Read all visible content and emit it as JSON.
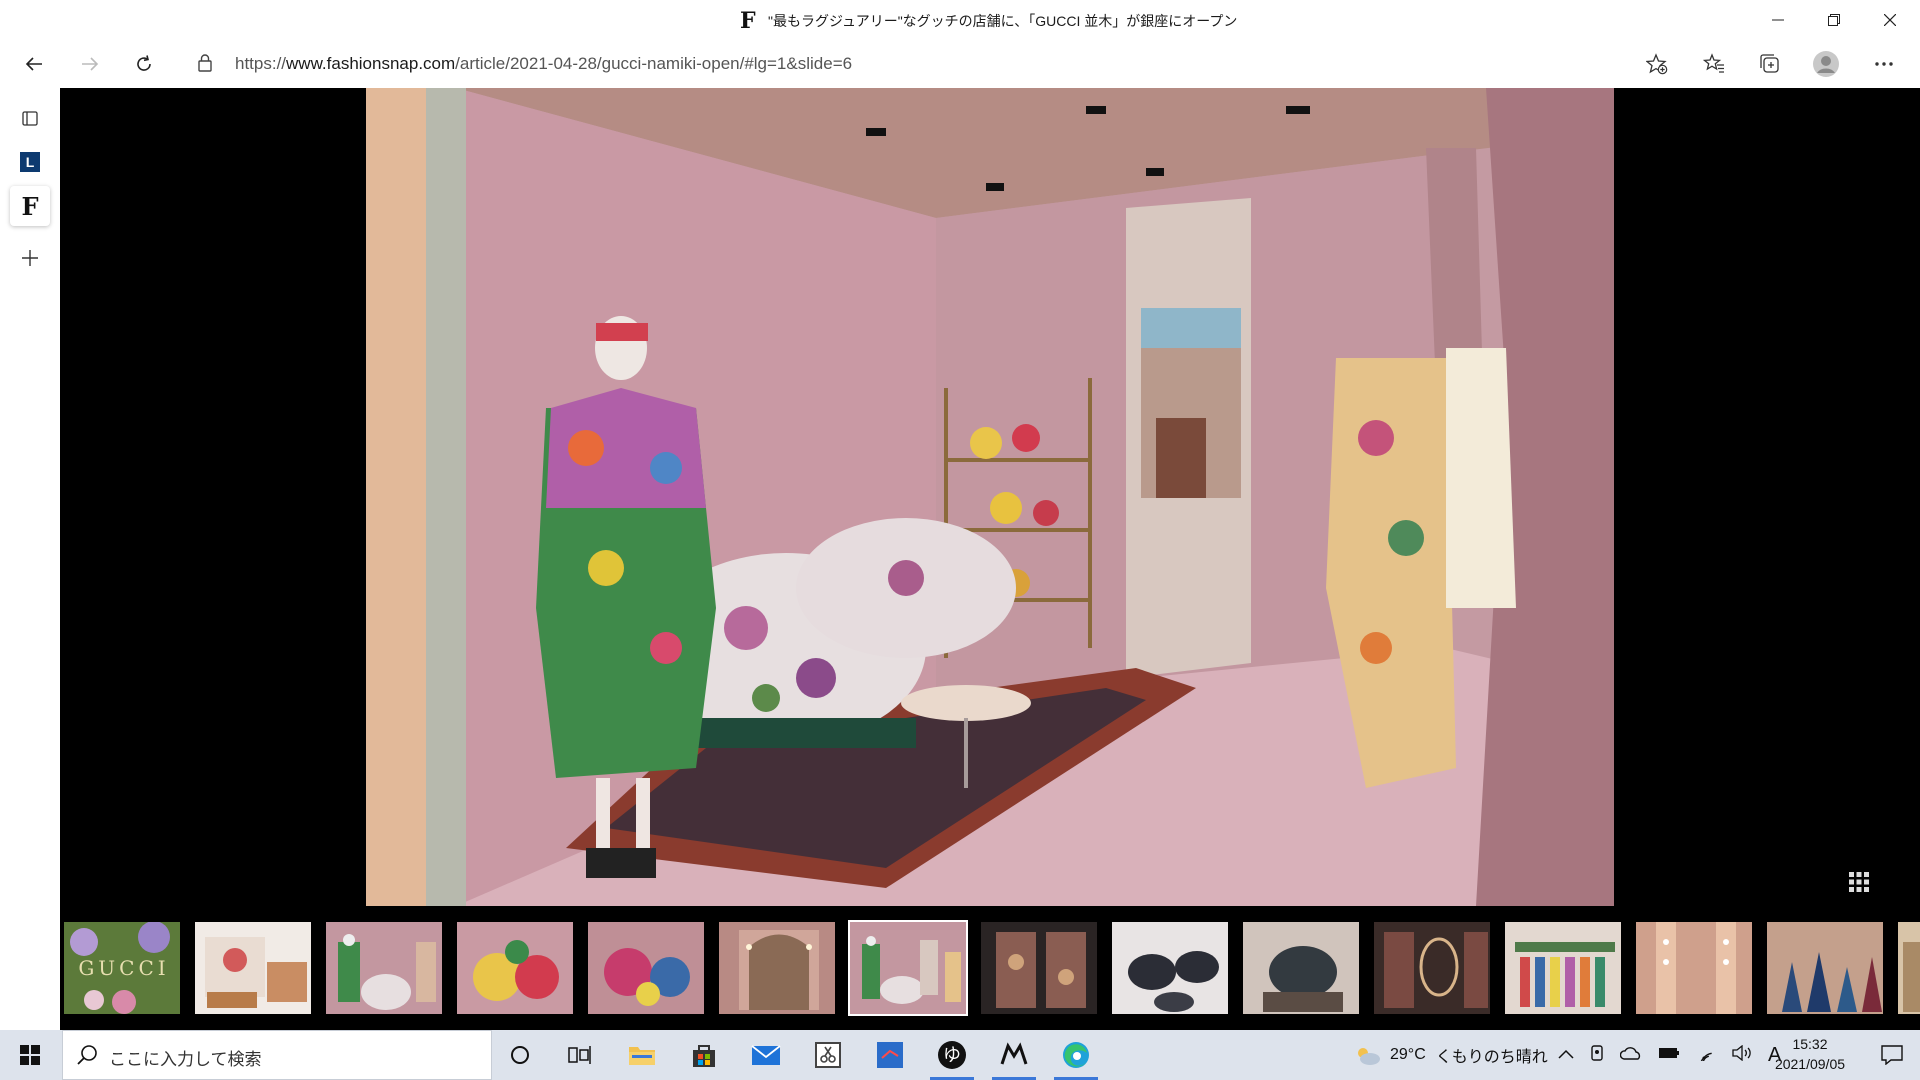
{
  "window": {
    "tab_title": "\"最もラグジュアリー\"なグッチの店舗に、「GUCCI 並木」が銀座にオープン",
    "favicon_letter": "F",
    "minimize_icon": "minimize-icon",
    "maximize_icon": "restore-icon",
    "close_icon": "close-icon"
  },
  "address_bar": {
    "url_prefix": "https://",
    "url_host": "www.fashionsnap.com",
    "url_path": "/article/2021-04-28/gucci-namiki-open/#lg=1&slide=6"
  },
  "sidebar": {
    "tabs": [
      {
        "name": "tab-actions",
        "icon": "tab-actions-icon"
      },
      {
        "name": "tab-l",
        "letter": "L"
      },
      {
        "name": "tab-fashionsnap",
        "letter": "F",
        "active": true
      },
      {
        "name": "new-tab",
        "icon": "plus-icon"
      }
    ]
  },
  "viewer": {
    "current_slide": 6,
    "thumbnail_count": 15,
    "active_thumbnail_index": 6,
    "gallery_logo_text": "GUCCI"
  },
  "taskbar": {
    "search_placeholder": "ここに入力して検索",
    "weather_temp": "29°C",
    "weather_text": "くもりのち晴れ",
    "ime_indicator": "A",
    "time": "15:32",
    "date": "2021/09/05"
  },
  "colors": {
    "viewer_bg": "#000000",
    "taskbar_bg": "#dde3ec",
    "running_indicator": "#3b78d8",
    "room_pink": "#c49aa2"
  }
}
